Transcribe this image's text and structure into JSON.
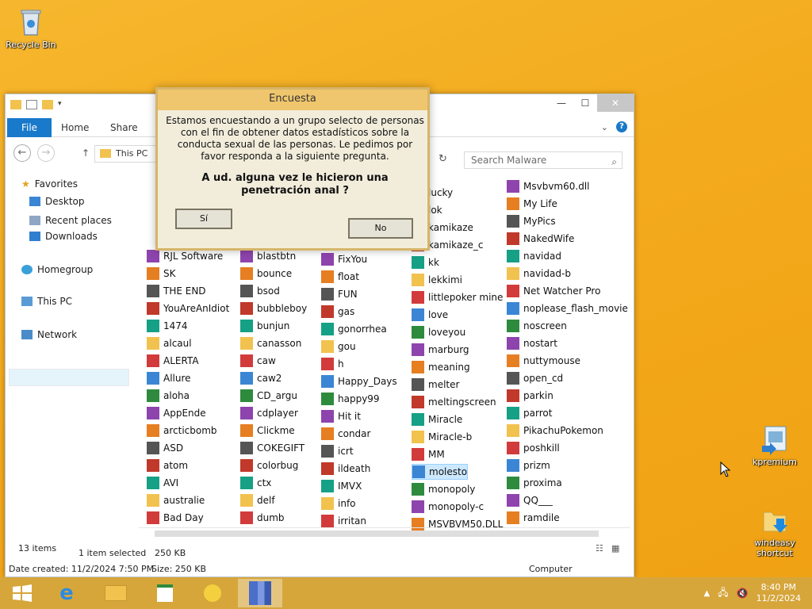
{
  "desktop": {
    "recycle_bin": "Recycle Bin",
    "kpremium": "kpremium",
    "windeasy": "windeasy shortcut"
  },
  "explorer": {
    "ribbon_tabs": [
      "File",
      "Home",
      "Share"
    ],
    "address": "This PC",
    "search_placeholder": "Search Malware",
    "nav": {
      "favorites": "Favorites",
      "desktop": "Desktop",
      "recent": "Recent places",
      "downloads": "Downloads",
      "homegroup": "Homegroup",
      "thispc": "This PC",
      "network": "Network"
    },
    "files": {
      "col1": [
        "RJL Software",
        "SK",
        "THE END",
        "YouAreAnIdiot",
        "1474",
        "alcaul",
        "ALERTA",
        "Allure",
        "aloha",
        "AppEnde",
        "arcticbomb",
        "ASD",
        "atom",
        "AVI",
        "australie",
        "Bad Day"
      ],
      "col2": [
        "blastbtn",
        "bounce",
        "bsod",
        "bubbleboy",
        "bunjun",
        "canasson",
        "caw",
        "caw2",
        "CD_argu",
        "cdplayer",
        "Clickme",
        "COKEGIFT",
        "colorbug",
        "ctx",
        "delf",
        "dumb"
      ],
      "col3": [
        "FixYou",
        "float",
        "FUN",
        "gas",
        "gonorrhea",
        "gou",
        "h",
        "Happy_Days",
        "happy99",
        "Hit it",
        "condar",
        "icrt",
        "ildeath",
        "IMVX",
        "info",
        "irritan"
      ],
      "col4": [
        "lucky",
        "lok",
        "kamikaze",
        "kamikaze_c",
        "kk",
        "lekkimi",
        "littlepoker mine",
        "love",
        "loveyou",
        "marburg",
        "meaning",
        "melter",
        "meltingscreen",
        "Miracle",
        "Miracle-b",
        "MM",
        "molesto",
        "monopoly",
        "monopoly-c",
        "MSVBVM50.DLL"
      ],
      "col5": [
        "Msvbvm60.dll",
        "My Life",
        "MyPics",
        "NakedWife",
        "navidad",
        "navidad-b",
        "Net Watcher Pro",
        "noplease_flash_movie",
        "noscreen",
        "nostart",
        "nuttymouse",
        "open_cd",
        "parkin",
        "parrot",
        "PikachuPokemon",
        "poshkill",
        "prizm",
        "proxima",
        "QQ___",
        "ramdile"
      ],
      "selected": "molesto"
    },
    "status": {
      "items": "13 items",
      "selected": "1 item selected",
      "size": "250 KB",
      "date": "Date created: 11/2/2024 7:50 PM",
      "size2": "Size: 250 KB",
      "computer": "Computer"
    }
  },
  "dialog": {
    "title": "Encuesta",
    "body": "Estamos encuestando a un grupo selecto de personas con el fin de obtener datos estadísticos sobre la conducta sexual de las personas. Le pedimos por favor responda a la siguiente pregunta.",
    "question": "A ud. alguna vez le hicieron una penetración anal ?",
    "yes": "Sí",
    "no": "No"
  },
  "taskbar": {
    "time": "8:40 PM",
    "date": "11/2/2024"
  },
  "colors": {
    "desktop": "#f3aa1c",
    "file_tab": "#1979ca",
    "dialog_title": "#efc66d"
  }
}
